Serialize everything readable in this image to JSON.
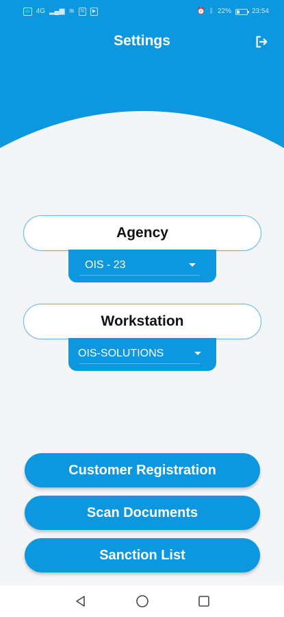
{
  "status_bar": {
    "left_icons": [
      "sim-icon",
      "signal-icon",
      "wifi-icon",
      "nfc-icon",
      "youtube-icon"
    ],
    "network_label": "4G",
    "alarm_icon": "alarm-icon",
    "bluetooth_icon": "bluetooth-icon",
    "battery_percent": "22%",
    "time": "23:54"
  },
  "header": {
    "title": "Settings",
    "logout_icon": "logout-icon"
  },
  "agency": {
    "label": "Agency",
    "selected": "OIS - 23"
  },
  "workstation": {
    "label": "Workstation",
    "selected": "OIS-SOLUTIONS"
  },
  "actions": {
    "customer_registration": "Customer Registration",
    "scan_documents": "Scan Documents",
    "sanction_list": "Sanction List"
  },
  "nav": {
    "back_icon": "triangle-back-icon",
    "home_icon": "circle-home-icon",
    "recents_icon": "square-recents-icon"
  },
  "colors": {
    "primary": "#0c97de",
    "background": "#f4f5f7",
    "text_dark": "#111111"
  }
}
